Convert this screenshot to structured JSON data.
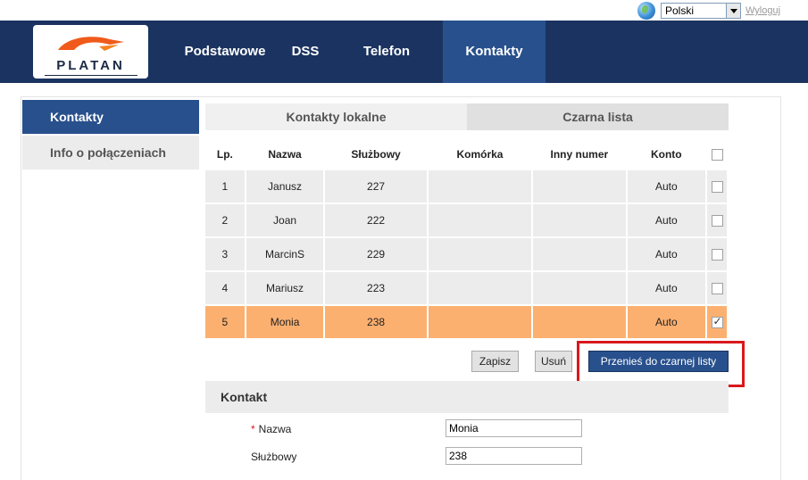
{
  "topbar": {
    "language_value": "Polski",
    "logout_label": "Wyloguj"
  },
  "header": {
    "logo_text": "PLATAN",
    "nav": [
      {
        "label": "Podstawowe",
        "active": false
      },
      {
        "label": "DSS",
        "active": false
      },
      {
        "label": "Telefon",
        "active": false
      },
      {
        "label": "Kontakty",
        "active": true
      }
    ]
  },
  "sidebar": {
    "items": [
      {
        "label": "Kontakty",
        "active": true
      },
      {
        "label": "Info o połączeniach",
        "active": false
      }
    ]
  },
  "tabs": [
    {
      "label": "Kontakty lokalne",
      "active": true
    },
    {
      "label": "Czarna lista",
      "active": false
    }
  ],
  "table": {
    "headers": [
      "Lp.",
      "Nazwa",
      "Służbowy",
      "Komórka",
      "Inny numer",
      "Konto"
    ],
    "rows": [
      {
        "lp": "1",
        "nazwa": "Janusz",
        "sluzbowy": "227",
        "komorka": "",
        "inny": "",
        "konto": "Auto",
        "checked": false
      },
      {
        "lp": "2",
        "nazwa": "Joan",
        "sluzbowy": "222",
        "komorka": "",
        "inny": "",
        "konto": "Auto",
        "checked": false
      },
      {
        "lp": "3",
        "nazwa": "MarcinS",
        "sluzbowy": "229",
        "komorka": "",
        "inny": "",
        "konto": "Auto",
        "checked": false
      },
      {
        "lp": "4",
        "nazwa": "Mariusz",
        "sluzbowy": "223",
        "komorka": "",
        "inny": "",
        "konto": "Auto",
        "checked": false
      },
      {
        "lp": "5",
        "nazwa": "Monia",
        "sluzbowy": "238",
        "komorka": "",
        "inny": "",
        "konto": "Auto",
        "checked": true
      }
    ]
  },
  "actions": {
    "save_label": "Zapisz",
    "delete_label": "Usuń",
    "move_label": "Przenieś do czarnej listy"
  },
  "contact_form": {
    "section_title": "Kontakt",
    "required_marker": "*",
    "name_label": "Nazwa",
    "name_value": "Monia",
    "work_label": "Służbowy",
    "work_value": "238"
  },
  "colors": {
    "header_bg": "#1b3360",
    "active_bg": "#28508d",
    "selected_row": "#fcb070",
    "highlight_border": "#d9181e"
  }
}
